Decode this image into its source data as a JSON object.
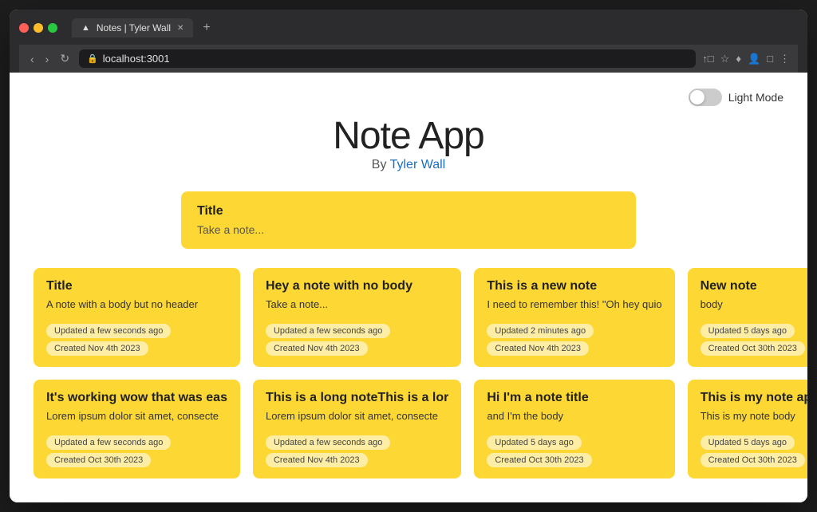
{
  "browser": {
    "traffic_lights": [
      "red",
      "yellow",
      "green"
    ],
    "tab_label": "Notes | Tyler Wall",
    "tab_icon": "▲",
    "tab_close": "✕",
    "new_tab": "+",
    "address": "localhost:3001",
    "nav": {
      "back": "‹",
      "forward": "›",
      "reload": "↻"
    },
    "toolbar_icons": [
      "↑□",
      "☆",
      "♦",
      "⚡",
      "□",
      "●",
      "⋮"
    ]
  },
  "page": {
    "title": "Note App",
    "subtitle_prefix": "By ",
    "subtitle_author": "Tyler Wall",
    "light_mode_label": "Light Mode"
  },
  "note_input": {
    "title": "Title",
    "placeholder": "Take a note..."
  },
  "notes": [
    {
      "title": "Title",
      "body": "A note with a body but no header",
      "updated": "Updated a few seconds ago",
      "created": "Created Nov 4th 2023"
    },
    {
      "title": "Hey a note with no body",
      "body": "Take a note...",
      "updated": "Updated a few seconds ago",
      "created": "Created Nov 4th 2023"
    },
    {
      "title": "This is a new note",
      "body": "I need to remember this! \"Oh hey quio",
      "updated": "Updated 2 minutes ago",
      "created": "Created Nov 4th 2023"
    },
    {
      "title": "New note",
      "body": "body",
      "updated": "Updated 5 days ago",
      "created": "Created Oct 30th 2023"
    },
    {
      "title": "It's working wow that was eas",
      "body": "Lorem ipsum dolor sit amet, consecte",
      "updated": "Updated a few seconds ago",
      "created": "Created Oct 30th 2023"
    },
    {
      "title": "This is a long noteThis is a lor",
      "body": "Lorem ipsum dolor sit amet, consecte",
      "updated": "Updated a few seconds ago",
      "created": "Created Nov 4th 2023"
    },
    {
      "title": "Hi I'm a note title",
      "body": "and I'm the body",
      "updated": "Updated 5 days ago",
      "created": "Created Oct 30th 2023"
    },
    {
      "title": "This is my note app hello",
      "body": "This is my note body",
      "updated": "Updated 5 days ago",
      "created": "Created Oct 30th 2023"
    }
  ]
}
